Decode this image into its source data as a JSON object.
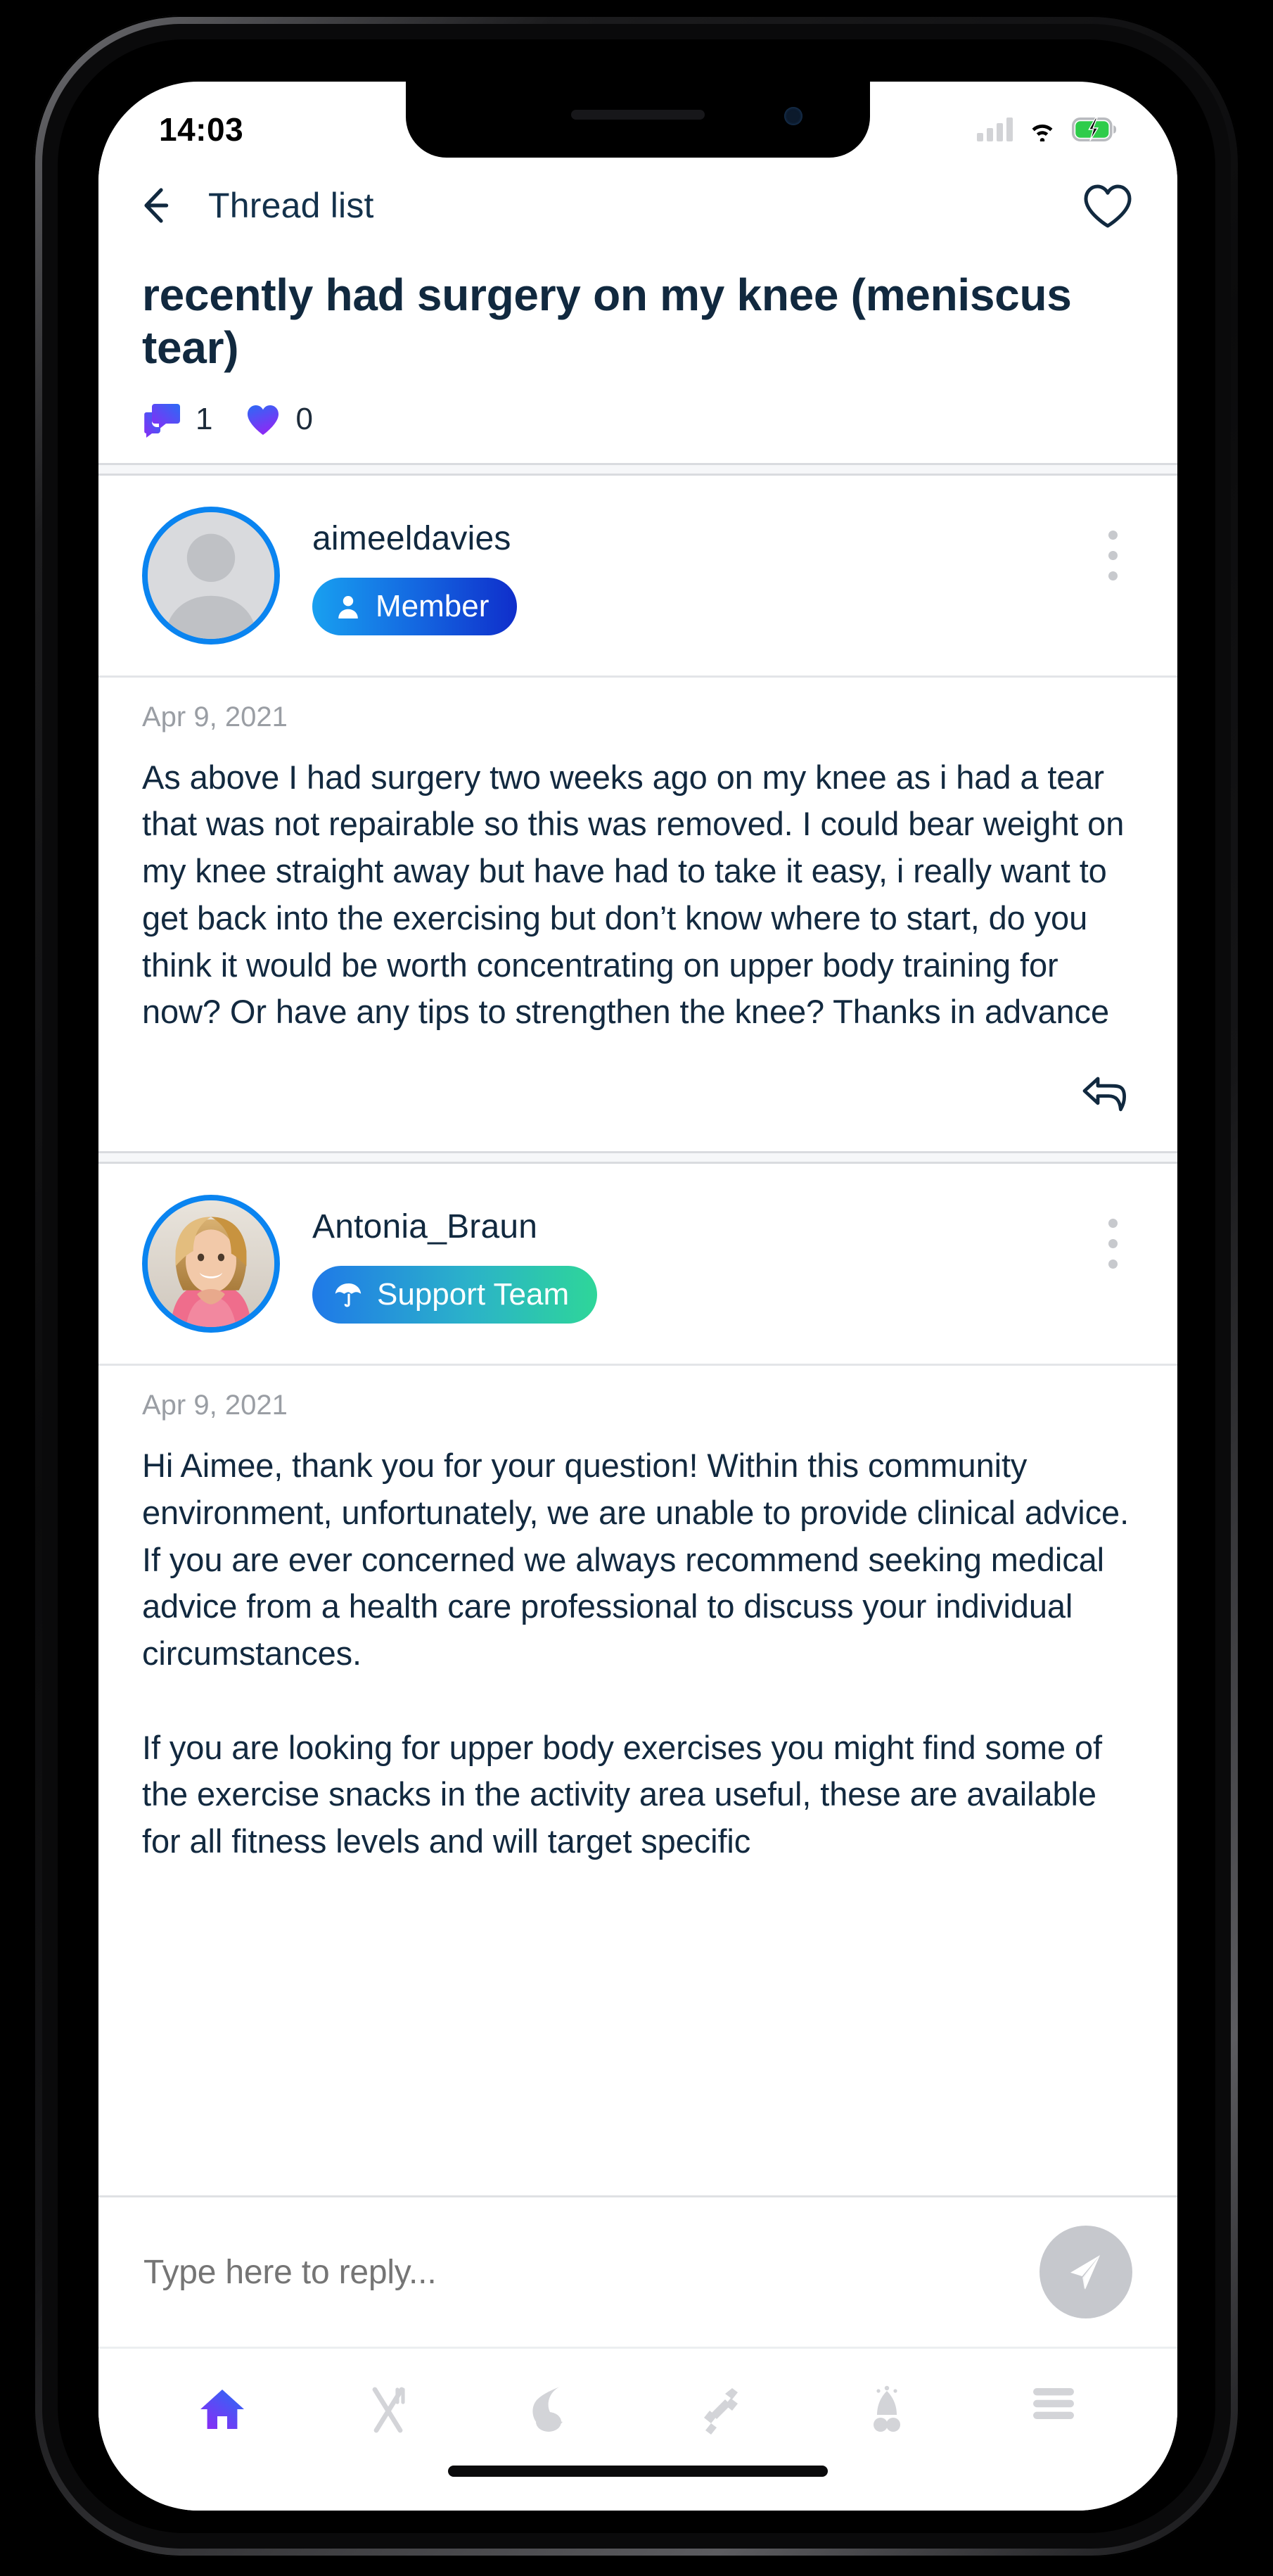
{
  "statusbar": {
    "time": "14:03",
    "cellular_icon": "cellular-bars-icon",
    "wifi_icon": "wifi-icon",
    "battery_icon": "battery-charging-icon",
    "battery_color": "#2ecc4a"
  },
  "navbar": {
    "back_icon": "arrow-left-icon",
    "title": "Thread list",
    "favorite_icon": "heart-outline-icon"
  },
  "thread": {
    "title": "recently had surgery on my knee (meniscus tear)",
    "replies_icon": "comments-icon",
    "replies_count": "1",
    "likes_icon": "heart-filled-icon",
    "likes_count": "0"
  },
  "posts": [
    {
      "author": "aimeeldavies",
      "avatar_type": "placeholder-silhouette",
      "badge_label": "Member",
      "badge_icon": "person-icon",
      "badge_style": "member",
      "date": "Apr 9, 2021",
      "text": "As above I had surgery two weeks ago on my knee as i had a tear that was not repairable so this was removed. I could bear weight on my knee straight away but have had to take it easy, i really want to get back into the exercising but don’t know where to start, do you think it would be worth concentrating on upper body training for now? Or have any tips to strengthen the knee? Thanks in advance",
      "reply_icon": "reply-arrow-icon",
      "menu_icon": "kebab-menu-icon"
    },
    {
      "author": "Antonia_Braun",
      "avatar_type": "photo",
      "badge_label": "Support Team",
      "badge_icon": "umbrella-icon",
      "badge_style": "support",
      "date": "Apr 9, 2021",
      "text": "Hi Aimee, thank you for your question! Within this community environment, unfortunately, we are unable to provide clinical advice. If you are ever concerned we always recommend seeking medical advice from a health care professional to discuss your individual circumstances.\n\nIf you are looking for upper body exercises you might find some of the exercise snacks in the activity area useful, these are available for all fitness levels and will target specific",
      "menu_icon": "kebab-menu-icon"
    }
  ],
  "reply": {
    "placeholder": "Type here to reply...",
    "value": "",
    "send_icon": "send-paper-plane-icon"
  },
  "tabbar": {
    "items": [
      {
        "name": "home",
        "icon": "home-icon",
        "active": true
      },
      {
        "name": "nutrition",
        "icon": "cutlery-icon",
        "active": false
      },
      {
        "name": "sleep",
        "icon": "moon-cloud-icon",
        "active": false
      },
      {
        "name": "activity",
        "icon": "dumbbell-icon",
        "active": false
      },
      {
        "name": "goals",
        "icon": "rocket-icon",
        "active": false
      },
      {
        "name": "menu",
        "icon": "hamburger-menu-icon",
        "active": false
      }
    ]
  },
  "colors": {
    "accent_navy": "#11293f",
    "accent_blue": "#0a84f0",
    "gradient_start": "#2b6bf5",
    "gradient_end": "#8a2bf5",
    "muted_gray": "#c7c9cd"
  }
}
